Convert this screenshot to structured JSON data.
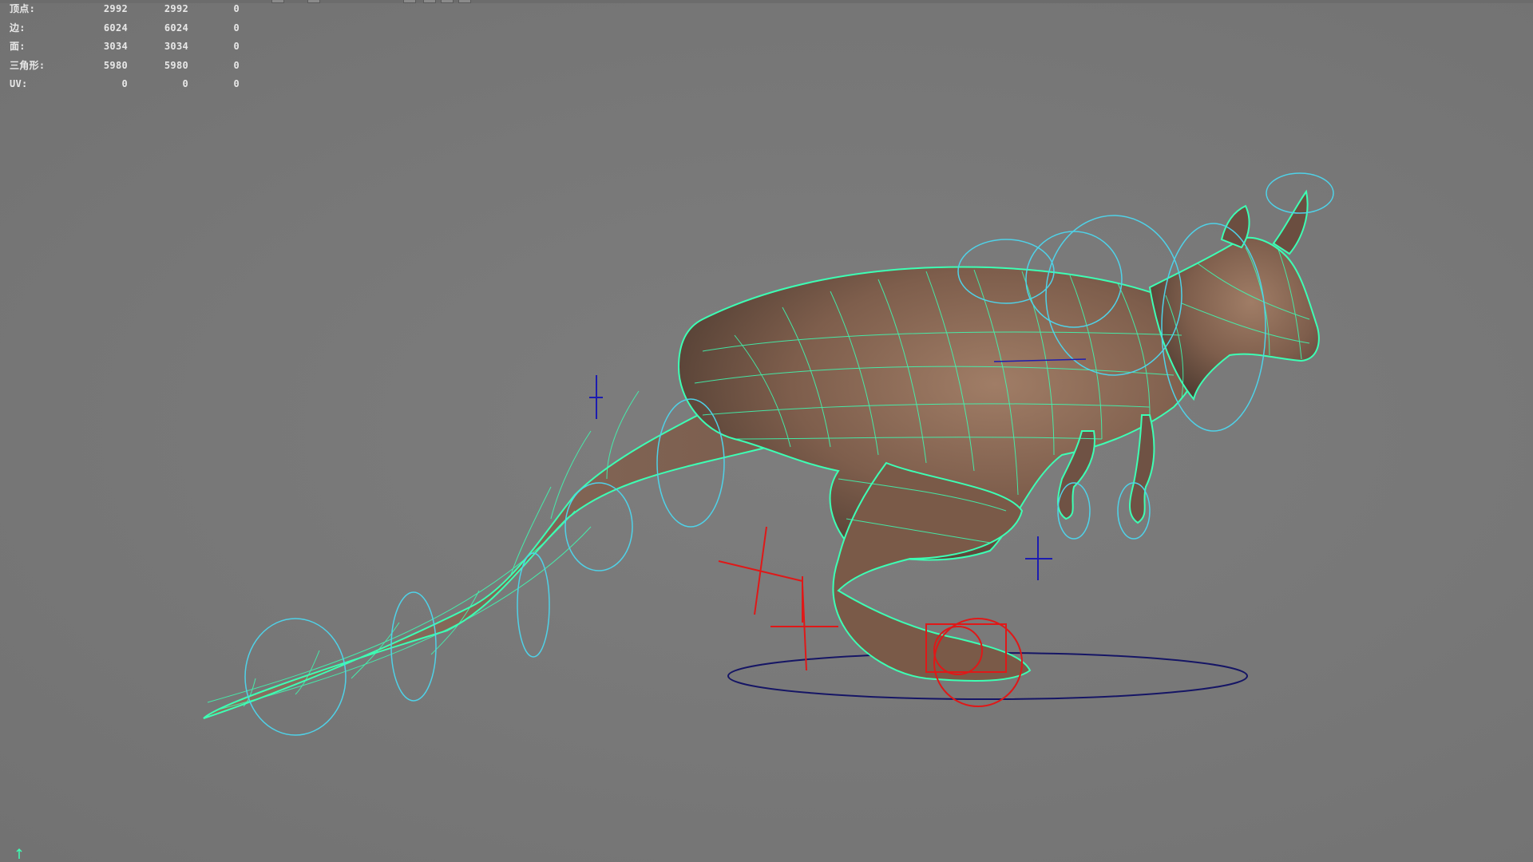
{
  "viewport": {
    "background_color": "#7a7a7a",
    "wire_color": "#3dffb4",
    "control_cyan": "#4fd2e8",
    "control_red": "#e01818",
    "control_blue": "#1c1cb0",
    "ground_circle": "#151565"
  },
  "hud": {
    "rows": [
      {
        "label": "顶点:",
        "v1": "2992",
        "v2": "2992",
        "v3": "0"
      },
      {
        "label": "边:",
        "v1": "6024",
        "v2": "6024",
        "v3": "0"
      },
      {
        "label": "面:",
        "v1": "3034",
        "v2": "3034",
        "v3": "0"
      },
      {
        "label": "三角形:",
        "v1": "5980",
        "v2": "5980",
        "v3": "0"
      },
      {
        "label": "UV:",
        "v1": "0",
        "v2": "0",
        "v3": "0"
      }
    ]
  },
  "toolbar": {
    "icons": [
      "toolbar-icon-1",
      "toolbar-icon-2",
      "toolbar-icon-3",
      "toolbar-icon-4",
      "toolbar-icon-5",
      "toolbar-icon-6"
    ]
  },
  "scene": {
    "model_name_icon": "kangaroo-mesh",
    "axis_icon": "axis-y-icon"
  }
}
